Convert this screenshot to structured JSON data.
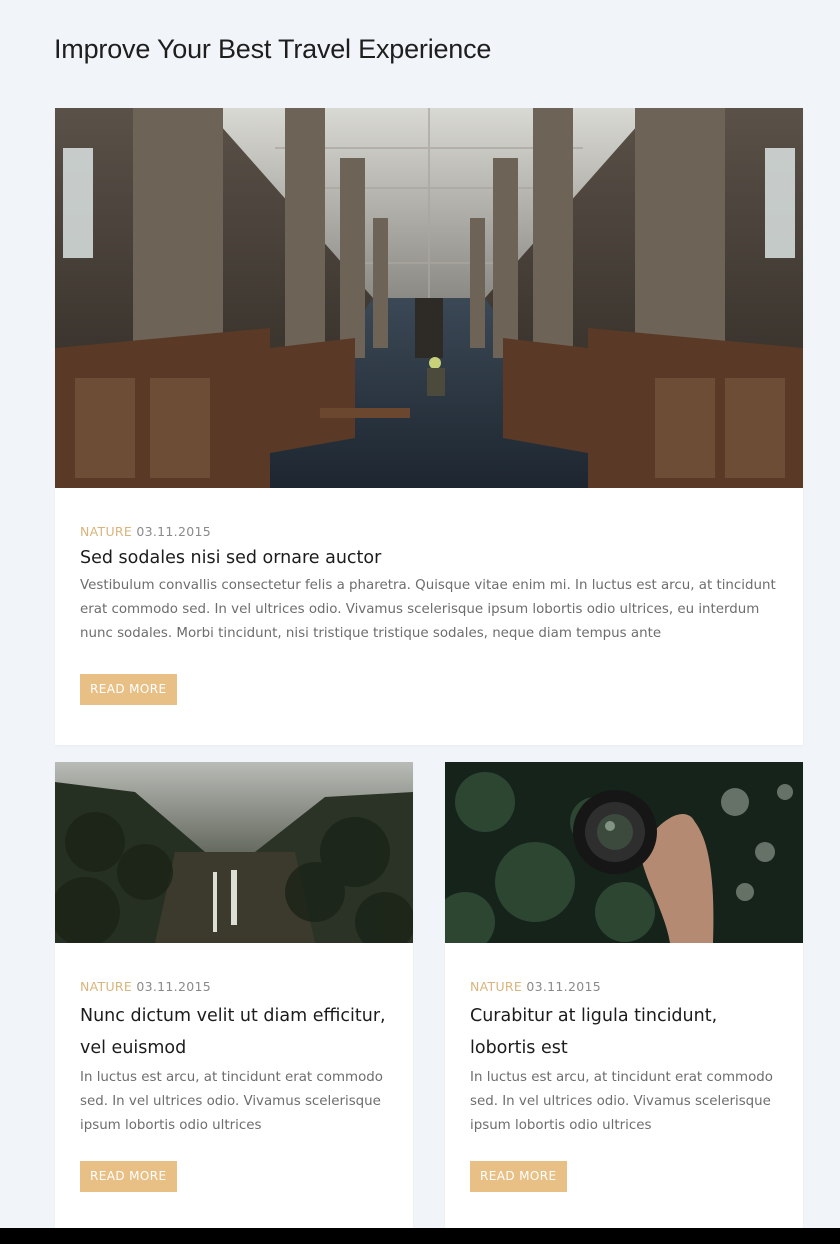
{
  "section": {
    "title": "Improve Your Best Travel Experience"
  },
  "posts": [
    {
      "image": "library-hall-photo",
      "category": "NATURE",
      "date": "03.11.2015",
      "title": "Sed sodales nisi sed ornare auctor",
      "excerpt": "Vestibulum convallis consectetur felis a pharetra. Quisque vitae enim mi. In luctus est arcu, at tincidunt erat commodo sed. In vel ultrices odio. Vivamus scelerisque ipsum lobortis odio ultrices, eu interdum nunc sodales. Morbi tincidunt, nisi tristique tristique sodales, neque diam tempus ante",
      "button": "READ MORE"
    },
    {
      "image": "misty-waterfall-photo",
      "category": "NATURE",
      "date": "03.11.2015",
      "title": "Nunc dictum velit ut diam efficitur, vel euismod",
      "excerpt": "In luctus est arcu, at tincidunt erat commodo sed. In vel ultrices odio. Vivamus scelerisque ipsum lobortis odio ultrices",
      "button": "READ MORE"
    },
    {
      "image": "hand-holding-lens-photo",
      "category": "NATURE",
      "date": "03.11.2015",
      "title": "Curabitur at ligula tincidunt, lobortis est",
      "excerpt": "In luctus est arcu, at tincidunt erat commodo sed. In vel ultrices odio. Vivamus scelerisque ipsum lobortis odio ultrices",
      "button": "READ MORE"
    }
  ],
  "colors": {
    "background": "#f1f4f9",
    "accent": "#e8c086",
    "category": "#d9b47c",
    "text": "#1c1c1c",
    "muted": "#6d6d6d"
  }
}
